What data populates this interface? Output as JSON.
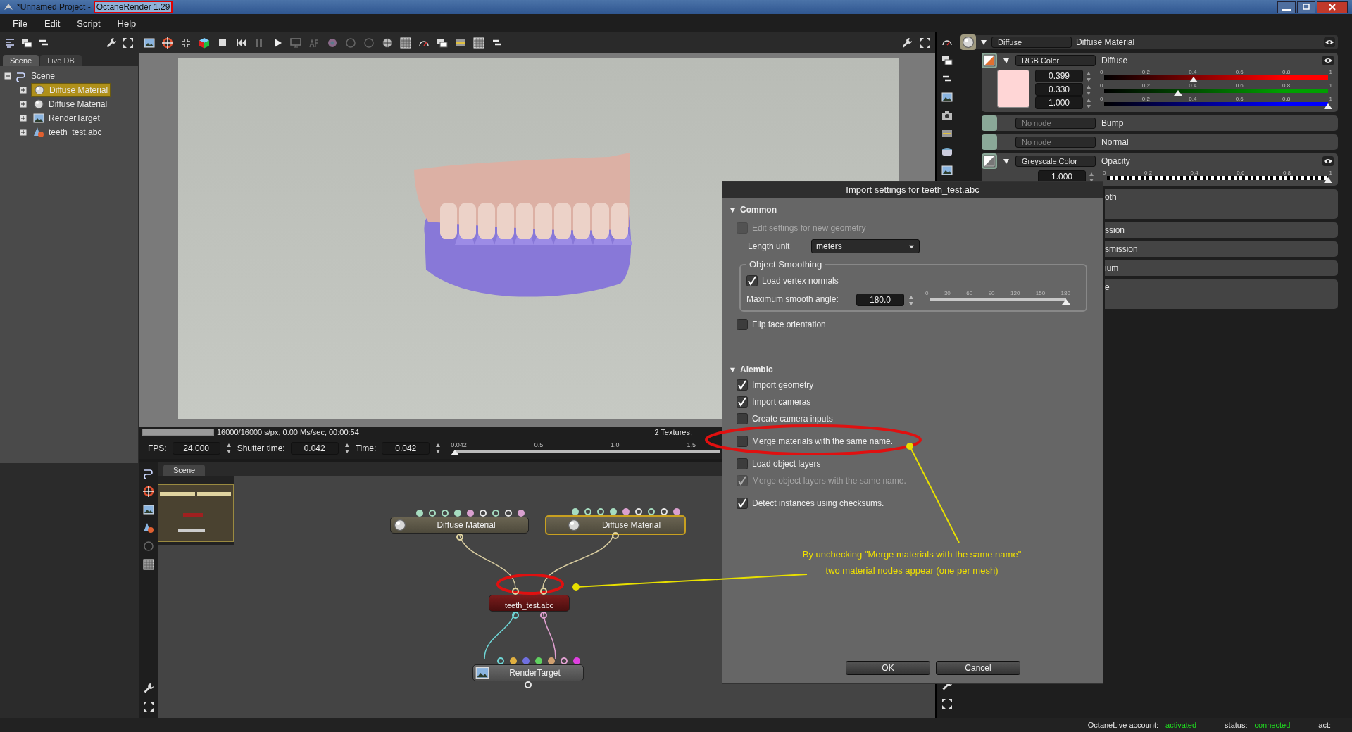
{
  "window": {
    "title": "*Unnamed Project - ",
    "app_name": "OctaneRender 1.29"
  },
  "menu": [
    "File",
    "Edit",
    "Script",
    "Help"
  ],
  "scene_panel": {
    "tabs": [
      {
        "label": "Scene",
        "selected": true
      },
      {
        "label": "Live DB",
        "selected": false
      }
    ],
    "tree": {
      "label": "Scene",
      "expanded": true,
      "children": [
        {
          "label": "Diffuse Material",
          "kind": "material",
          "selected": true,
          "expanded": false
        },
        {
          "label": "Diffuse Material",
          "kind": "material",
          "selected": false,
          "expanded": false
        },
        {
          "label": "RenderTarget",
          "kind": "target",
          "selected": false,
          "expanded": false
        },
        {
          "label": "teeth_test.abc",
          "kind": "mesh",
          "selected": false,
          "expanded": false
        }
      ]
    }
  },
  "viewport": {
    "progress": {
      "level": 1
    },
    "stats": "16000/16000 s/px, 0.00 Ms/sec, 00:00:54",
    "stats_right": "2 Textures, ",
    "fps_label": "FPS:",
    "fps": "24.000",
    "shutter_label": "Shutter time:",
    "shutter": "0.042",
    "time_label": "Time:",
    "time": "0.042",
    "timeline": {
      "ticks": [
        "0.042",
        "0.5",
        "1.0",
        "1.5"
      ],
      "level": 0
    }
  },
  "node_graph": {
    "tab": "Scene",
    "nodes": [
      {
        "label": "Diffuse Material",
        "kind": "material",
        "selected": false,
        "inputs": [
          {
            "color": "#a6dcc0",
            "filled": true
          },
          {
            "color": "#a6dcc0",
            "filled": false
          },
          {
            "color": "#a6dcc0",
            "filled": false
          },
          {
            "color": "#a6dcc0",
            "filled": true
          },
          {
            "color": "#d9a0cf",
            "filled": true
          },
          {
            "color": "#e6e6e6",
            "filled": false
          },
          {
            "color": "#a6dcc0",
            "filled": false
          },
          {
            "color": "#e6e6e6",
            "filled": false
          },
          {
            "color": "#d9a0cf",
            "filled": true
          }
        ],
        "outputs": [
          {
            "color": "#e0d4a0",
            "filled": false
          }
        ]
      },
      {
        "label": "Diffuse Material",
        "kind": "material",
        "selected": true,
        "inputs": [
          {
            "color": "#a6dcc0",
            "filled": true
          },
          {
            "color": "#a6dcc0",
            "filled": false
          },
          {
            "color": "#a6dcc0",
            "filled": false
          },
          {
            "color": "#a6dcc0",
            "filled": true
          },
          {
            "color": "#d9a0cf",
            "filled": true
          },
          {
            "color": "#e6e6e6",
            "filled": false
          },
          {
            "color": "#a6dcc0",
            "filled": false
          },
          {
            "color": "#e6e6e6",
            "filled": false
          },
          {
            "color": "#d9a0cf",
            "filled": true
          }
        ],
        "outputs": [
          {
            "color": "#e0d4a0",
            "filled": false
          }
        ]
      },
      {
        "label": "teeth_test.abc",
        "kind": "mesh",
        "selected": false,
        "inputs": [
          {
            "color": "#e0d4a0",
            "filled": false
          },
          {
            "color": "#e0d4a0",
            "filled": false
          }
        ],
        "outputs": [
          {
            "color": "#6fd6d6",
            "filled": false
          },
          {
            "color": "#e0a0d0",
            "filled": false
          }
        ]
      },
      {
        "label": "RenderTarget",
        "kind": "target",
        "selected": false,
        "inputs": [
          {
            "color": "#6fd6d6",
            "filled": false
          },
          {
            "color": "#e0b040",
            "filled": true
          },
          {
            "color": "#7070e0",
            "filled": true
          },
          {
            "color": "#60d060",
            "filled": true
          },
          {
            "color": "#d0a070",
            "filled": true
          },
          {
            "color": "#e0a0d0",
            "filled": false
          },
          {
            "color": "#e040e0",
            "filled": true
          }
        ],
        "outputs": [
          {
            "color": "#e6e6e6",
            "filled": false
          }
        ]
      }
    ]
  },
  "inspector": {
    "node_type": "Diffuse",
    "title": "Diffuse Material",
    "pins": [
      {
        "kind": "rgb",
        "type": "RGB Color",
        "name": "Diffuse",
        "channels": [
          {
            "value": "0.399",
            "level": 0.399,
            "color": "#ff0000",
            "ticks": [
              "0",
              "0.2",
              "0.4",
              "0.6",
              "0.8",
              "1"
            ]
          },
          {
            "value": "0.330",
            "level": 0.33,
            "color": "#00a000",
            "ticks": [
              "0",
              "0.2",
              "0.4",
              "0.6",
              "0.8",
              "1"
            ]
          },
          {
            "value": "1.000",
            "level": 1,
            "color": "#0000ff",
            "ticks": [
              "0",
              "0.2",
              "0.4",
              "0.6",
              "0.8",
              "1"
            ]
          }
        ]
      },
      {
        "kind": "empty",
        "type": "No node",
        "name": "Bump"
      },
      {
        "kind": "empty",
        "type": "No node",
        "name": "Normal"
      },
      {
        "kind": "grey",
        "type": "Greyscale Color",
        "name": "Opacity",
        "channels": [
          {
            "value": "1.000",
            "level": 1,
            "ticks": [
              "0",
              "0.2",
              "0.4",
              "0.6",
              "0.8",
              "1"
            ]
          }
        ]
      },
      {
        "kind": "covered",
        "name": "oth",
        "tall": true
      },
      {
        "kind": "covered",
        "name": "ssion",
        "tall": false
      },
      {
        "kind": "covered",
        "name": "smission",
        "tall": false
      },
      {
        "kind": "covered",
        "name": "ium",
        "tall": false
      },
      {
        "kind": "covered",
        "name": "e",
        "tall": true
      }
    ]
  },
  "dialog": {
    "title": "Import settings for teeth_test.abc",
    "sections": [
      {
        "title": "Common",
        "expanded": true,
        "items": [
          {
            "kind": "check",
            "label": "Edit settings for new geometry",
            "checked": false,
            "disabled": true
          },
          {
            "kind": "select",
            "label": "Length unit",
            "value": "meters"
          },
          {
            "kind": "group",
            "title": "Object Smoothing",
            "items": [
              {
                "kind": "check",
                "label": "Load vertex normals",
                "checked": true,
                "disabled": false
              },
              {
                "kind": "slider",
                "label": "Maximum smooth angle:",
                "value": "180.0",
                "level": 1,
                "ticks": [
                  "0",
                  "30",
                  "60",
                  "90",
                  "120",
                  "150",
                  "180"
                ]
              }
            ]
          },
          {
            "kind": "check",
            "label": "Flip face orientation",
            "checked": false,
            "disabled": false
          }
        ]
      },
      {
        "title": "Alembic",
        "expanded": true,
        "items": [
          {
            "kind": "check",
            "label": "Import geometry",
            "checked": true,
            "disabled": false
          },
          {
            "kind": "check",
            "label": "Import cameras",
            "checked": true,
            "disabled": false
          },
          {
            "kind": "check",
            "label": "Create camera inputs",
            "checked": false,
            "disabled": false
          },
          {
            "kind": "check",
            "label": "Merge materials with the same name.",
            "checked": false,
            "disabled": false
          },
          {
            "kind": "check",
            "label": "Load object layers",
            "checked": false,
            "disabled": false
          },
          {
            "kind": "check",
            "label": "Merge object layers with the same name.",
            "checked": true,
            "disabled": true
          },
          {
            "kind": "check",
            "label": "Detect instances using checksums.",
            "checked": true,
            "disabled": false
          }
        ]
      }
    ],
    "buttons": [
      "OK",
      "Cancel"
    ]
  },
  "annotation": {
    "lines": [
      "By unchecking \"Merge materials with the same name\"",
      "two material nodes appear (one per mesh)"
    ]
  },
  "status_bar": [
    {
      "label": "OctaneLive account:",
      "value": "activated"
    },
    {
      "label": "status:",
      "value": "connected"
    },
    {
      "label": "act:"
    }
  ]
}
